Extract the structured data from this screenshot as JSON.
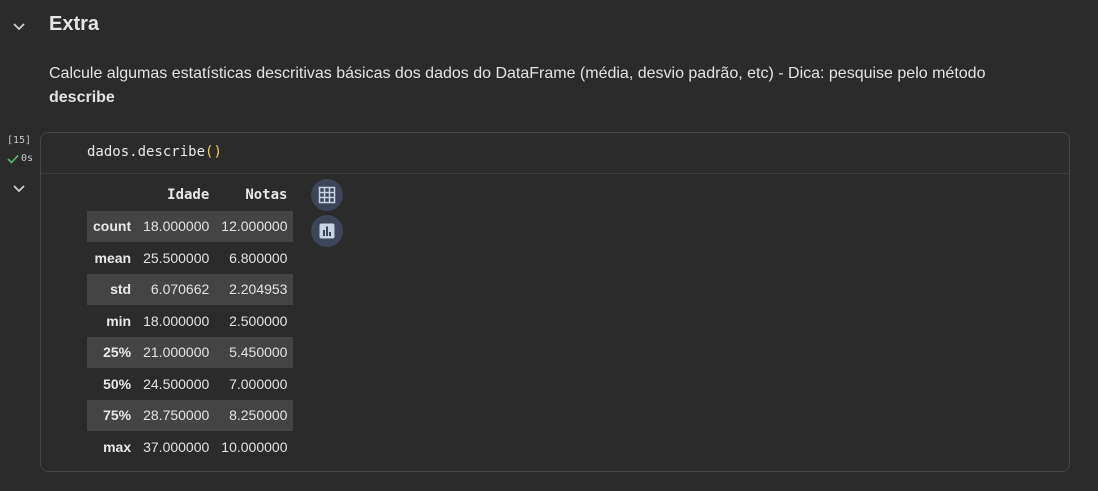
{
  "section": {
    "title": "Extra",
    "description": "Calcule algumas estatísticas descritivas básicas dos dados do DataFrame (média, desvio padrão, etc) - Dica: pesquise pelo método",
    "description_bold": "describe"
  },
  "cell": {
    "execution_count": "[15]",
    "duration": "0s",
    "code_prefix": "dados.describe",
    "code_parens": "()"
  },
  "table": {
    "columns": [
      "",
      "Idade",
      "Notas"
    ],
    "rows": [
      {
        "label": "count",
        "idade": "18.000000",
        "notas": "12.000000"
      },
      {
        "label": "mean",
        "idade": "25.500000",
        "notas": "6.800000"
      },
      {
        "label": "std",
        "idade": "6.070662",
        "notas": "2.204953"
      },
      {
        "label": "min",
        "idade": "18.000000",
        "notas": "2.500000"
      },
      {
        "label": "25%",
        "idade": "21.000000",
        "notas": "5.450000"
      },
      {
        "label": "50%",
        "idade": "24.500000",
        "notas": "7.000000"
      },
      {
        "label": "75%",
        "idade": "28.750000",
        "notas": "8.250000"
      },
      {
        "label": "max",
        "idade": "37.000000",
        "notas": "10.000000"
      }
    ]
  },
  "icons": {
    "collapse": "chevron-down-icon",
    "status": "check-icon",
    "table_view": "table-grid-icon",
    "chart_suggest": "bar-chart-icon"
  },
  "colors": {
    "background": "#2b2b2b",
    "check": "#5bb974",
    "paren": "#f5d33e",
    "icon_bubble": "#3d4658"
  }
}
